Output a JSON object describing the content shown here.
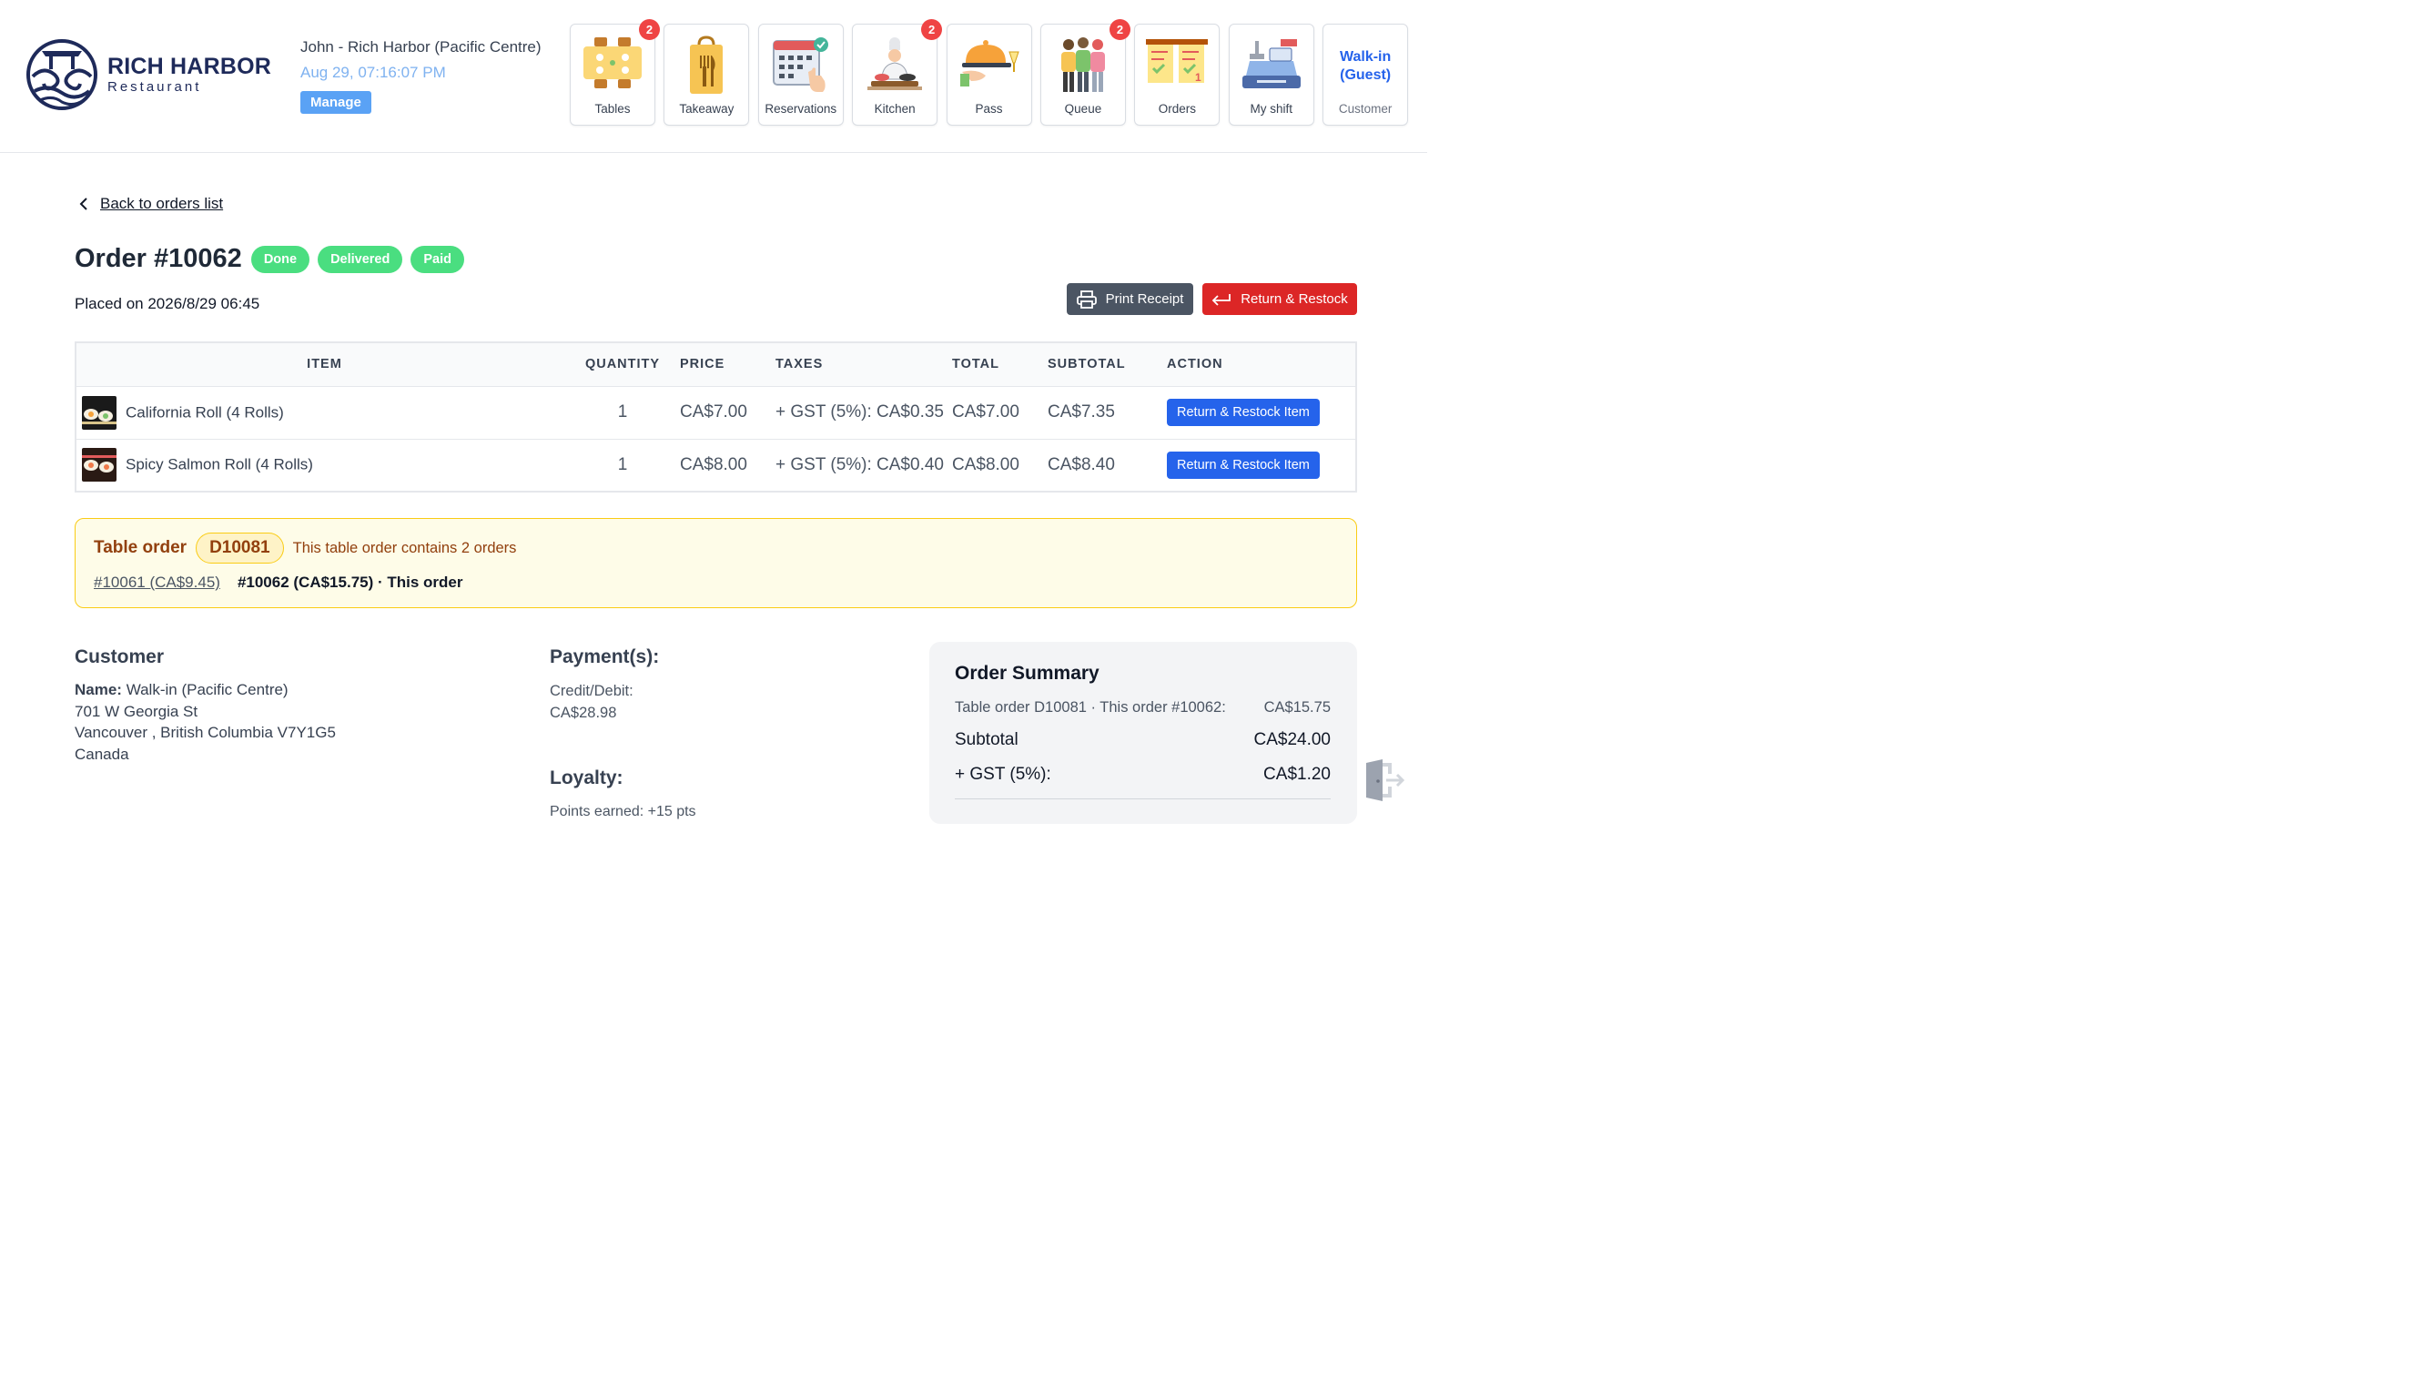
{
  "brand": {
    "name": "RICH HARBOR",
    "sub": "Restaurant"
  },
  "user": {
    "name": "John - Rich Harbor (Pacific Centre)",
    "datetime": "Aug 29, 07:16:07 PM",
    "manage_label": "Manage"
  },
  "nav": [
    {
      "label": "Tables",
      "badge": "2",
      "icon": "tables-icon"
    },
    {
      "label": "Takeaway",
      "badge": "",
      "icon": "takeaway-bag-icon"
    },
    {
      "label": "Reservations",
      "badge": "",
      "icon": "calendar-icon"
    },
    {
      "label": "Kitchen",
      "badge": "2",
      "icon": "chef-icon"
    },
    {
      "label": "Pass",
      "badge": "",
      "icon": "serving-cloche-icon"
    },
    {
      "label": "Queue",
      "badge": "2",
      "icon": "people-queue-icon"
    },
    {
      "label": "Orders",
      "badge": "",
      "icon": "order-tickets-icon"
    },
    {
      "label": "My shift",
      "badge": "",
      "icon": "cash-register-icon"
    }
  ],
  "customer_tile": {
    "name": "Walk-in (Guest)",
    "label": "Customer"
  },
  "back_label": "Back to orders list",
  "order": {
    "title": "Order #10062",
    "statuses": [
      "Done",
      "Delivered",
      "Paid"
    ],
    "placed": "Placed on 2026/8/29 06:45"
  },
  "actions": {
    "print": "Print Receipt",
    "return": "Return & Restock"
  },
  "table": {
    "headers": [
      "ITEM",
      "QUANTITY",
      "PRICE",
      "TAXES",
      "TOTAL",
      "SUBTOTAL",
      "ACTION"
    ],
    "rows": [
      {
        "item": "California Roll (4 Rolls)",
        "quantity": "1",
        "price": "CA$7.00",
        "taxes": "+ GST (5%): CA$0.35",
        "total": "CA$7.00",
        "subtotal": "CA$7.35",
        "action": "Return & Restock Item"
      },
      {
        "item": "Spicy Salmon Roll (4 Rolls)",
        "quantity": "1",
        "price": "CA$8.00",
        "taxes": "+ GST (5%): CA$0.40",
        "total": "CA$8.00",
        "subtotal": "CA$8.40",
        "action": "Return & Restock Item"
      }
    ]
  },
  "table_order": {
    "title": "Table order",
    "code": "D10081",
    "note": "This table order contains 2 orders",
    "other_order": "#10061 (CA$9.45)",
    "this_order": "#10062 (CA$15.75) · This order"
  },
  "customer": {
    "title": "Customer",
    "name_label": "Name:",
    "name": " Walk-in (Pacific Centre)",
    "address1": "701 W Georgia St",
    "address2": "Vancouver , British Columbia V7Y1G5",
    "country": "Canada"
  },
  "payments": {
    "title": "Payment(s):",
    "method": "Credit/Debit:",
    "amount": "CA$28.98"
  },
  "loyalty": {
    "title": "Loyalty:",
    "line": "Points earned: +15 pts"
  },
  "summary": {
    "title": "Order Summary",
    "table_line_label": "Table order D10081 · This order #10062:",
    "table_line_value": "CA$15.75",
    "subtotal_label": "Subtotal",
    "subtotal_value": "CA$24.00",
    "gst_label": "+ GST (5%):",
    "gst_value": "CA$1.20"
  },
  "colors": {
    "primary": "#2563eb",
    "danger": "#dc2626",
    "success": "#4ade80",
    "brand": "#1e2a5a",
    "warning_bg": "#fefce8"
  }
}
